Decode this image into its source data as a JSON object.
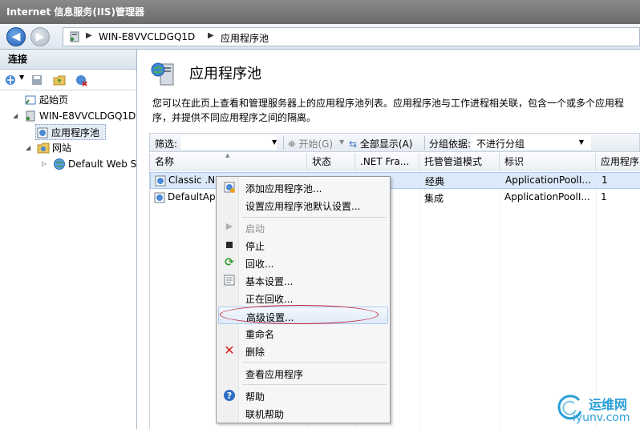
{
  "window": {
    "title": "Internet 信息服务(IIS)管理器"
  },
  "address": {
    "segments": [
      "WIN-E8VVCLDGQ1D",
      "应用程序池"
    ],
    "separator": "▶"
  },
  "left_panel": {
    "header": "连接",
    "tree": [
      {
        "label": "起始页"
      },
      {
        "label": "WIN-E8VVCLDGQ1D"
      },
      {
        "label": "应用程序池"
      },
      {
        "label": "网站"
      },
      {
        "label": "Default Web S"
      }
    ]
  },
  "main": {
    "title": "应用程序池",
    "description": "您可以在此页上查看和管理服务器上的应用程序池列表。应用程序池与工作进程相关联，包含一个或多个应用程序，并提供不同应用程序之间的隔离。",
    "filter": {
      "label": "筛选:",
      "start_label": "开始(G)",
      "show_all_label": "全部显示(A)",
      "group_by_label": "分组依据:",
      "group_by_value": "不进行分组"
    },
    "columns": [
      "名称",
      "状态",
      ".NET Fra...",
      "托管管道模式",
      "标识",
      "应用程序"
    ],
    "rows": [
      {
        "name": "Classic .NE",
        "status": "",
        "net": "",
        "pipeline": "经典",
        "identity": "ApplicationPoolI...",
        "apps": "1"
      },
      {
        "name": "DefaultAp",
        "status": "",
        "net": "",
        "pipeline": "集成",
        "identity": "ApplicationPoolI...",
        "apps": "1"
      }
    ]
  },
  "context_menu": {
    "items": [
      {
        "label": "添加应用程序池...",
        "icon": "app-pool-add-icon"
      },
      {
        "label": "设置应用程序池默认设置...",
        "icon": ""
      },
      {
        "label": "启动",
        "icon": "play-icon"
      },
      {
        "label": "停止",
        "icon": "stop-icon"
      },
      {
        "label": "回收...",
        "icon": "recycle-icon"
      },
      {
        "label": "基本设置...",
        "icon": "settings-icon"
      },
      {
        "label": "正在回收...",
        "icon": ""
      },
      {
        "label": "高级设置...",
        "icon": ""
      },
      {
        "label": "重命名",
        "icon": ""
      },
      {
        "label": "删除",
        "icon": "delete-icon"
      },
      {
        "label": "查看应用程序",
        "icon": ""
      },
      {
        "label": "帮助",
        "icon": "help-icon"
      },
      {
        "label": "联机帮助",
        "icon": ""
      }
    ]
  },
  "watermark": {
    "cn": "运维网",
    "en": "iyunv.com"
  },
  "colors": {
    "accent": "#1f5db5",
    "selection": "#dce9f8",
    "annotation": "#c0223a"
  }
}
